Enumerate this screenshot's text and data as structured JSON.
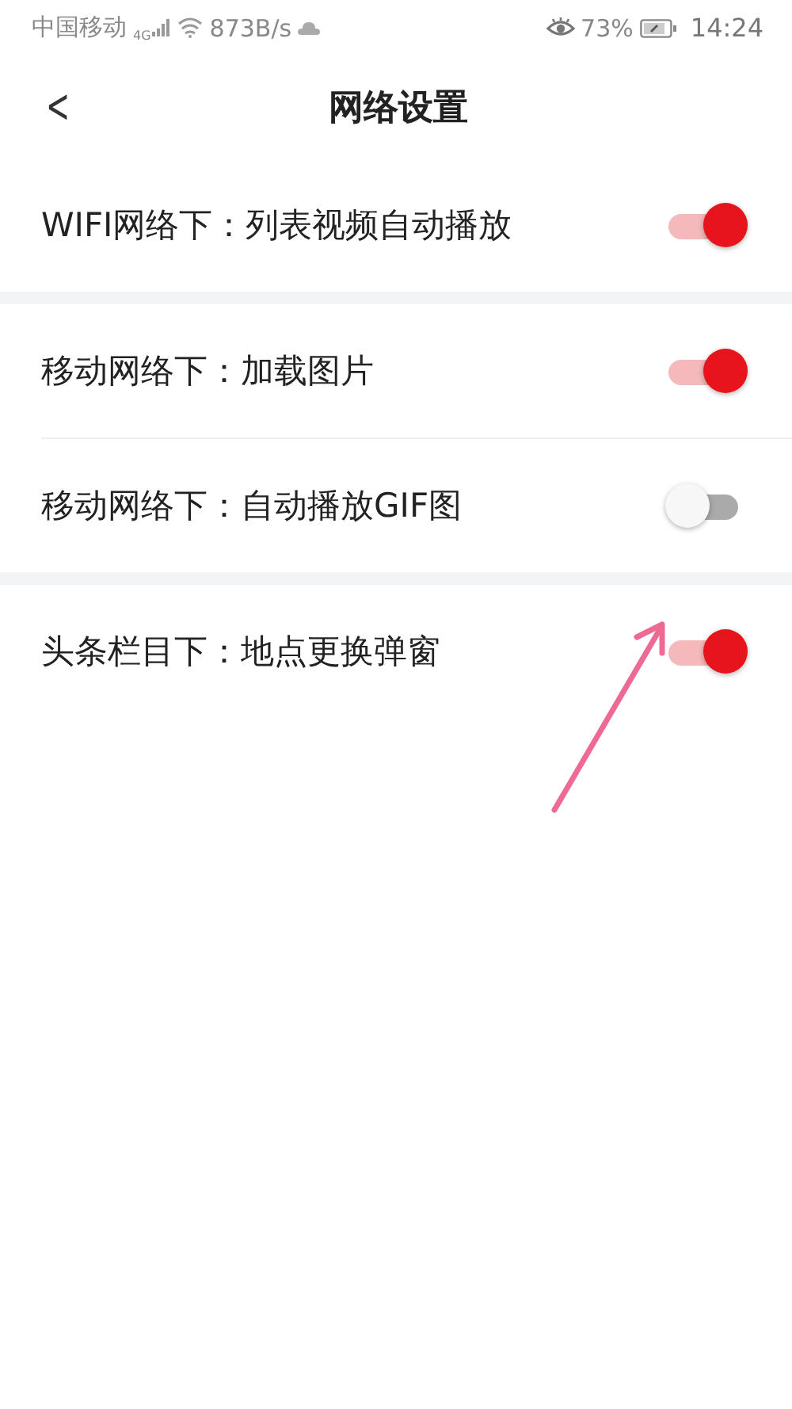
{
  "status_bar": {
    "carrier": "中国移动",
    "network": "4G",
    "speed": "873B/s",
    "battery": "73%",
    "time": "14:24"
  },
  "header": {
    "back": "<",
    "title": "网络设置"
  },
  "groups": [
    {
      "items": [
        {
          "label": "WIFI网络下：列表视频自动播放",
          "on": true
        }
      ]
    },
    {
      "items": [
        {
          "label": "移动网络下：加载图片",
          "on": true
        },
        {
          "label": "移动网络下：自动播放GIF图",
          "on": false
        }
      ]
    },
    {
      "items": [
        {
          "label": "头条栏目下：地点更换弹窗",
          "on": true
        }
      ]
    }
  ]
}
